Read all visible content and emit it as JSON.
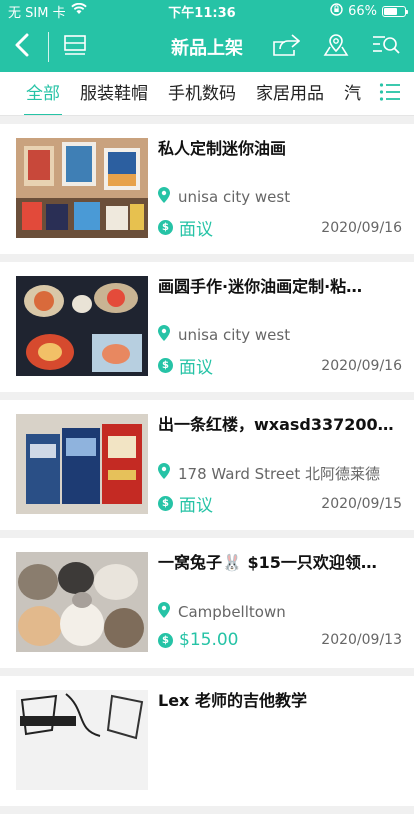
{
  "status": {
    "carrier": "无 SIM 卡",
    "time": "下午11:36",
    "battery": "66%",
    "battery_level": 0.66
  },
  "nav": {
    "title": "新品上架",
    "back_icon": "back-arrow-icon",
    "list_icon": "list-view-icon",
    "share_icon": "share-icon",
    "location_icon": "location-icon",
    "search_icon": "filter-search-icon"
  },
  "tabs": [
    {
      "label": "全部",
      "active": true
    },
    {
      "label": "服装鞋帽",
      "active": false
    },
    {
      "label": "手机数码",
      "active": false
    },
    {
      "label": "家居用品",
      "active": false
    },
    {
      "label": "汽",
      "active": false
    }
  ],
  "items": [
    {
      "title": "私人定制迷你油画",
      "location": "unisa city west",
      "price": "面议",
      "date": "2020/09/16"
    },
    {
      "title": "画圆手作·迷你油画定制·粘…",
      "location": "unisa city west",
      "price": "面议",
      "date": "2020/09/16"
    },
    {
      "title": "出一条红楼，wxasd337200…",
      "location": "178 Ward Street 北阿德莱德",
      "price": "面议",
      "date": "2020/09/15"
    },
    {
      "title": "一窝兔子🐰 $15一只欢迎领…",
      "location": "Campbelltown",
      "price": "$15.00",
      "date": "2020/09/13"
    },
    {
      "title": "Lex 老师的吉他教学",
      "location": "",
      "price": "",
      "date": ""
    }
  ],
  "colors": {
    "accent": "#26c3a6"
  }
}
